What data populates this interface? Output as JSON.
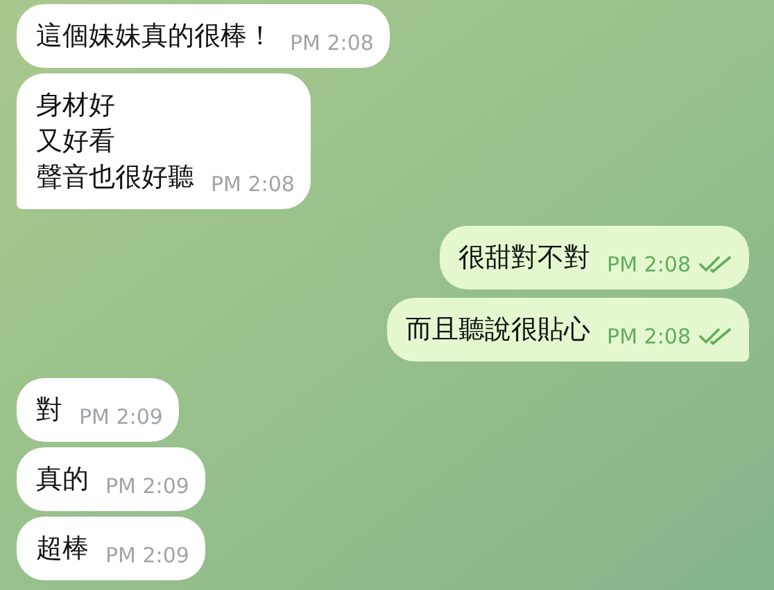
{
  "messages": [
    {
      "kind": "incoming",
      "lines": [
        "這個妹妹真的很棒！"
      ],
      "time": "PM 2:08",
      "tail": false
    },
    {
      "kind": "incoming",
      "lines": [
        "身材好",
        "又好看",
        "聲音也很好聽"
      ],
      "time": "PM 2:08",
      "tail": true
    },
    {
      "kind": "outgoing",
      "lines": [
        "很甜對不對"
      ],
      "time": "PM 2:08",
      "read": true,
      "tail": false
    },
    {
      "kind": "outgoing",
      "lines": [
        "而且聽說很貼心"
      ],
      "time": "PM 2:08",
      "read": true,
      "tail": true
    },
    {
      "kind": "incoming",
      "lines": [
        "對"
      ],
      "time": "PM 2:09",
      "tail": false
    },
    {
      "kind": "incoming",
      "lines": [
        "真的"
      ],
      "time": "PM 2:09",
      "tail": false
    },
    {
      "kind": "incoming",
      "lines": [
        "超棒"
      ],
      "time": "PM 2:09",
      "tail": false
    }
  ]
}
